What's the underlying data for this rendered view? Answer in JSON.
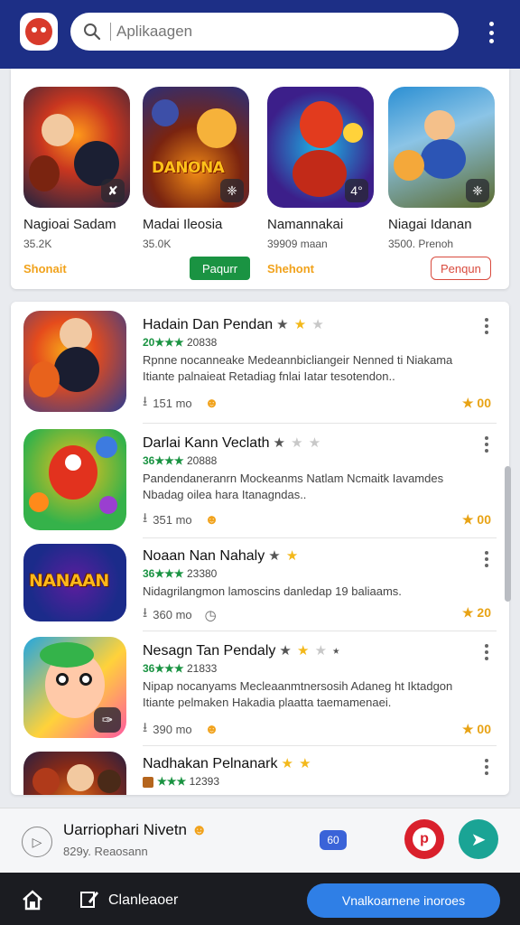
{
  "header": {
    "search_placeholder": "Aplikaagen",
    "search_icon": "search-icon",
    "menu_icon": "kebab-menu-icon"
  },
  "featured": [
    {
      "name": "Nagioai Sadam",
      "sub": "35.2K",
      "action": "Shonait",
      "badge": "✘",
      "colors": [
        "#c9361f",
        "#1e2340",
        "#ff9a1a"
      ]
    },
    {
      "name": "Madai Ileosia",
      "sub": "35.0K",
      "action": "Paqurr",
      "badge": "❈",
      "colors": [
        "#2a2f7a",
        "#f08a16",
        "#7a2410"
      ]
    },
    {
      "name": "Namannakai",
      "sub": "39909 maan",
      "action": "Shehont",
      "badge": "4°",
      "colors": [
        "#3c1f8a",
        "#e23b1e",
        "#1cb7e8"
      ]
    },
    {
      "name": "Niagai Idanan",
      "sub": "3500. Prenoh",
      "action": "Penqun",
      "badge": "❈",
      "colors": [
        "#2b8fd3",
        "#f4a83a",
        "#5b6a2e"
      ]
    }
  ],
  "list": [
    {
      "title": "Hadain Dan Pendan",
      "meta_rating": "20★★★",
      "meta_count": "20838",
      "desc": "Rpnne nocanneake Medeannbicliangeir Nenned ti Niakama Itiante palnaieat Retadiag fnlai Iatar tesotendon..",
      "downloads": "151 mo",
      "right": "★ 00",
      "stars": [
        "dark",
        "gold",
        "light"
      ],
      "colors": [
        "#2d3c8f",
        "#e54b1c",
        "#f6a21a"
      ]
    },
    {
      "title": "Darlai Kann Veclath",
      "meta_rating": "36★★★",
      "meta_count": "20888",
      "desc": "Pandendaneranrn Mockeanms Natlam Ncmaitk Iavamdes Nbadag oilea hara Itanagndas..",
      "downloads": "351 mo",
      "right": "★ 00",
      "stars": [
        "dark",
        "light",
        "light"
      ],
      "colors": [
        "#35b24a",
        "#f2c01a",
        "#e2321e"
      ]
    },
    {
      "title": "Noaan Nan Nahaly",
      "meta_rating": "36★★★",
      "meta_count": "23380",
      "desc": "Nidagrilangmon lamoscins danledap 19 baliaams.",
      "downloads": "360 mo",
      "right": "★ 20",
      "stars": [
        "dark",
        "gold"
      ],
      "colors": [
        "#1b2b8a",
        "#f4a81c",
        "#5c1d9e"
      ]
    },
    {
      "title": "Nesagn Tan Pendaly",
      "meta_rating": "36★★★",
      "meta_count": "21833",
      "desc": "Nipap nocanyams Mecleaanmtnersosih Adaneg ht Iktadgon Itiante pelmaken Hakadia plaatta taemamenaei.",
      "downloads": "390 mo",
      "right": "★ 00",
      "stars": [
        "dark",
        "gold",
        "light",
        "dark"
      ],
      "colors": [
        "#22a6e0",
        "#ff5aa0",
        "#ffd23a"
      ]
    },
    {
      "title": "Nadhakan Pelnanark",
      "meta_rating": "★★★",
      "meta_count": "12393",
      "desc": "",
      "downloads": "",
      "right": "",
      "stars": [
        "gold",
        "gold"
      ],
      "colors": [
        "#8a2a16",
        "#e0701c",
        "#2a2040"
      ]
    }
  ],
  "player": {
    "title": "Uarriophari Nivetn",
    "subtitle": "829y. Reaosann",
    "pill": "60",
    "red_btn": "p",
    "teal_icon": "send-icon"
  },
  "bottom": {
    "label": "Clanleaoer",
    "cta": "Vnalkoarnene inoroes"
  }
}
